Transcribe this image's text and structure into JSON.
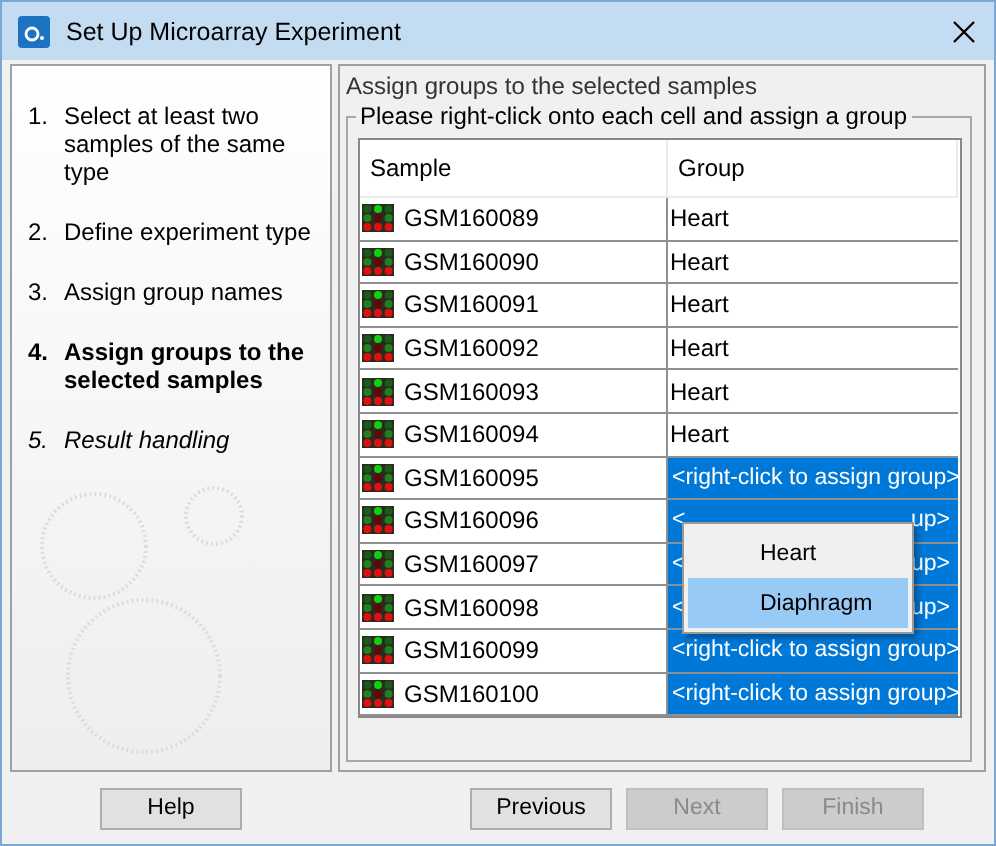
{
  "window": {
    "title": "Set Up Microarray Experiment"
  },
  "steps": [
    {
      "number": "1.",
      "label": "Select at least two samples of the same type",
      "current": false,
      "completed": true
    },
    {
      "number": "2.",
      "label": "Define experiment type",
      "current": false,
      "completed": true
    },
    {
      "number": "3.",
      "label": "Assign group names",
      "current": false,
      "completed": true
    },
    {
      "number": "4.",
      "label": "Assign groups to the selected samples",
      "current": true,
      "completed": false
    },
    {
      "number": "5.",
      "label": "Result handling",
      "current": false,
      "completed": false
    }
  ],
  "panel": {
    "heading": "Assign groups to the selected samples",
    "group_title": "Please right-click onto each cell and assign a group"
  },
  "table": {
    "columns": [
      "Sample",
      "Group"
    ],
    "rows": [
      {
        "sample": "GSM160089",
        "group": "Heart",
        "assigned": true
      },
      {
        "sample": "GSM160090",
        "group": "Heart",
        "assigned": true
      },
      {
        "sample": "GSM160091",
        "group": "Heart",
        "assigned": true
      },
      {
        "sample": "GSM160092",
        "group": "Heart",
        "assigned": true
      },
      {
        "sample": "GSM160093",
        "group": "Heart",
        "assigned": true
      },
      {
        "sample": "GSM160094",
        "group": "Heart",
        "assigned": true
      },
      {
        "sample": "GSM160095",
        "group": "<right-click to assign group>",
        "assigned": false
      },
      {
        "sample": "GSM160096",
        "group_left": "<",
        "group_right": "up>",
        "assigned": false
      },
      {
        "sample": "GSM160097",
        "group_left": "<",
        "group_right": "up>",
        "assigned": false
      },
      {
        "sample": "GSM160098",
        "group_left": "<",
        "group_right": "up>",
        "assigned": false
      },
      {
        "sample": "GSM160099",
        "group": "<right-click to assign group>",
        "assigned": false
      },
      {
        "sample": "GSM160100",
        "group": "<right-click to assign group>",
        "assigned": false
      }
    ]
  },
  "context_menu": {
    "items": [
      {
        "label": "Heart",
        "selected": false
      },
      {
        "label": "Diaphragm",
        "selected": true
      }
    ]
  },
  "buttons": [
    {
      "label": "Help",
      "disabled": false
    },
    {
      "label": "Previous",
      "disabled": false
    },
    {
      "label": "Next",
      "disabled": true
    },
    {
      "label": "Finish",
      "disabled": true
    }
  ]
}
